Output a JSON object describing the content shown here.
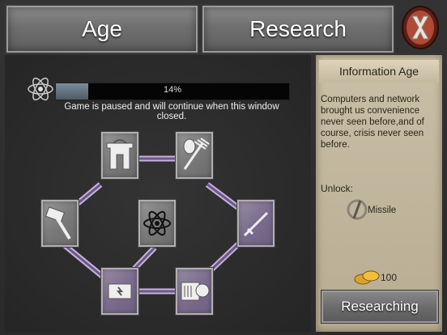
{
  "tabs": {
    "age_label": "Age",
    "research_label": "Research"
  },
  "progress": {
    "percent_label": "14%",
    "value": 0.14
  },
  "status_message": "Game is paused and will continue when this window closed.",
  "tech_nodes": [
    {
      "icon": "dome-building-icon"
    },
    {
      "icon": "pitchfork-icon"
    },
    {
      "icon": "hammer-icon"
    },
    {
      "icon": "atom-icon"
    },
    {
      "icon": "sword-icon"
    },
    {
      "icon": "generator-icon"
    },
    {
      "icon": "engine-icon"
    }
  ],
  "info_panel": {
    "title": "Information Age",
    "description": "Computers and network brought us convenience never seen before,and of course, crisis never seen before.",
    "unlock_label": "Unlock:",
    "unlock_item": "Missile",
    "cost": "100",
    "button_label": "Researching"
  },
  "colors": {
    "accent_link": "#c7b2dd",
    "panel_bg": "#c9bfa6",
    "close_red": "#a33a2e"
  }
}
